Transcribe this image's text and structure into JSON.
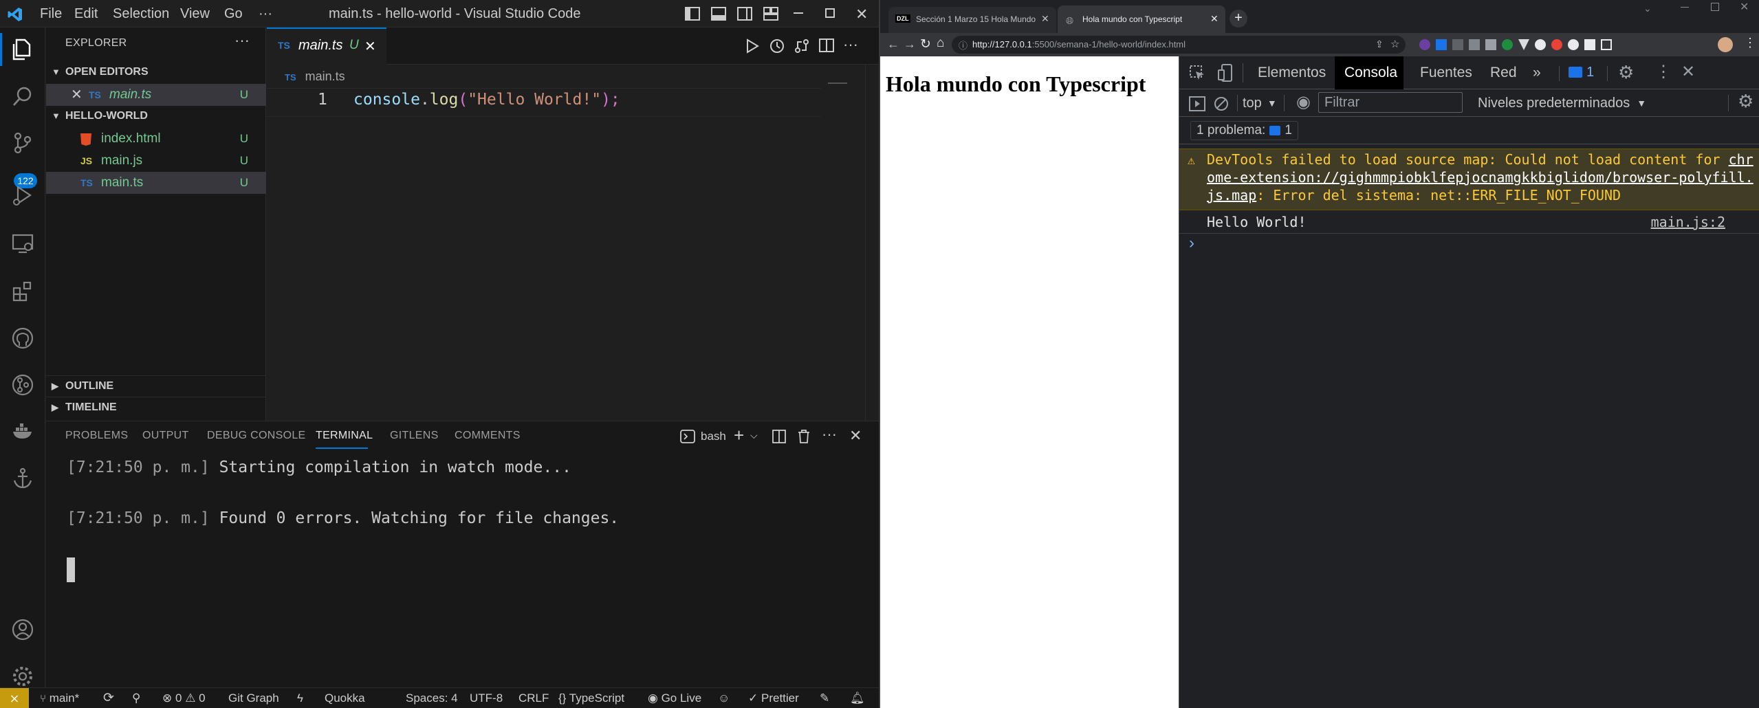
{
  "vscode": {
    "menu": [
      "File",
      "Edit",
      "Selection",
      "View",
      "Go",
      "···"
    ],
    "window_title": "main.ts - hello-world - Visual Studio Code",
    "source_control_badge": "122",
    "explorer": {
      "title": "EXPLORER",
      "more": "···",
      "open_editors_header": "OPEN EDITORS",
      "open_editor": {
        "icon": "TS",
        "name": "main.ts",
        "status": "U"
      },
      "folder_header": "HELLO-WORLD",
      "files": [
        {
          "icon": "html-icon",
          "name": "index.html",
          "status": "U"
        },
        {
          "icon": "JS",
          "name": "main.js",
          "status": "U"
        },
        {
          "icon": "TS",
          "name": "main.ts",
          "status": "U"
        }
      ],
      "outline_header": "OUTLINE",
      "timeline_header": "TIMELINE"
    },
    "editor": {
      "tab": {
        "icon": "TS",
        "name": "main.ts",
        "status": "U"
      },
      "breadcrumb": {
        "icon": "TS",
        "name": "main.ts"
      },
      "line_number": "1",
      "code": {
        "obj": "console",
        "dot": ".",
        "fn": "log",
        "open": "(",
        "str": "\"Hello World!\"",
        "close": ");"
      }
    },
    "panel": {
      "tabs": [
        "PROBLEMS",
        "OUTPUT",
        "DEBUG CONSOLE",
        "TERMINAL",
        "GITLENS",
        "COMMENTS"
      ],
      "active_tab": "TERMINAL",
      "shell": "bash",
      "terminal_lines": [
        {
          "time": "[7:21:50 p. m.]",
          "text": " Starting compilation in watch mode..."
        },
        {
          "time": "[7:21:50 p. m.]",
          "text": " Found 0 errors. Watching for file changes."
        }
      ]
    },
    "statusbar": {
      "branch": "main*",
      "errors": "0",
      "warnings": "0",
      "git_graph": "Git Graph",
      "quokka": "Quokka",
      "spaces": "Spaces: 4",
      "encoding": "UTF-8",
      "eol": "CRLF",
      "language": "TypeScript",
      "go_live": "Go Live",
      "prettier": "Prettier"
    }
  },
  "browser": {
    "tabs": [
      {
        "favicon": "DZL",
        "title": "Sección 1 Marzo 15 Hola Mundo"
      },
      {
        "favicon": "globe-icon",
        "title": "Hola mundo con Typescript"
      }
    ],
    "url_host": "http://127.0.0.1",
    "url_path": ":5500/semana-1/hello-world/index.html",
    "page_heading": "Hola mundo con Typescript",
    "devtools": {
      "tabs": [
        "Elementos",
        "Consola",
        "Fuentes",
        "Red"
      ],
      "active_tab": "Consola",
      "issues_badge": "1",
      "context": "top",
      "filter_placeholder": "Filtrar",
      "levels": "Niveles predeterminados",
      "problems_label": "1 problema:",
      "problems_count": "1",
      "warning": {
        "line1a": "DevTools failed to load source map: Could not load content for ",
        "line1b": "chr",
        "line2": "ome-extension://gighmmpiobklfepjocnamgkkbiglidom/browser-polyfill.",
        "line3a": "js.map",
        "line3b": ": Error del sistema: net::ERR_FILE_NOT_FOUND"
      },
      "log": {
        "message": "Hello World!",
        "source": "main.js:2"
      },
      "prompt": "›"
    }
  },
  "colors": {
    "accent": "#0078d4",
    "ts_blue": "#3178c6",
    "untracked_green": "#73c991",
    "warning_text": "#fcc934",
    "warning_bg": "#413c26"
  }
}
